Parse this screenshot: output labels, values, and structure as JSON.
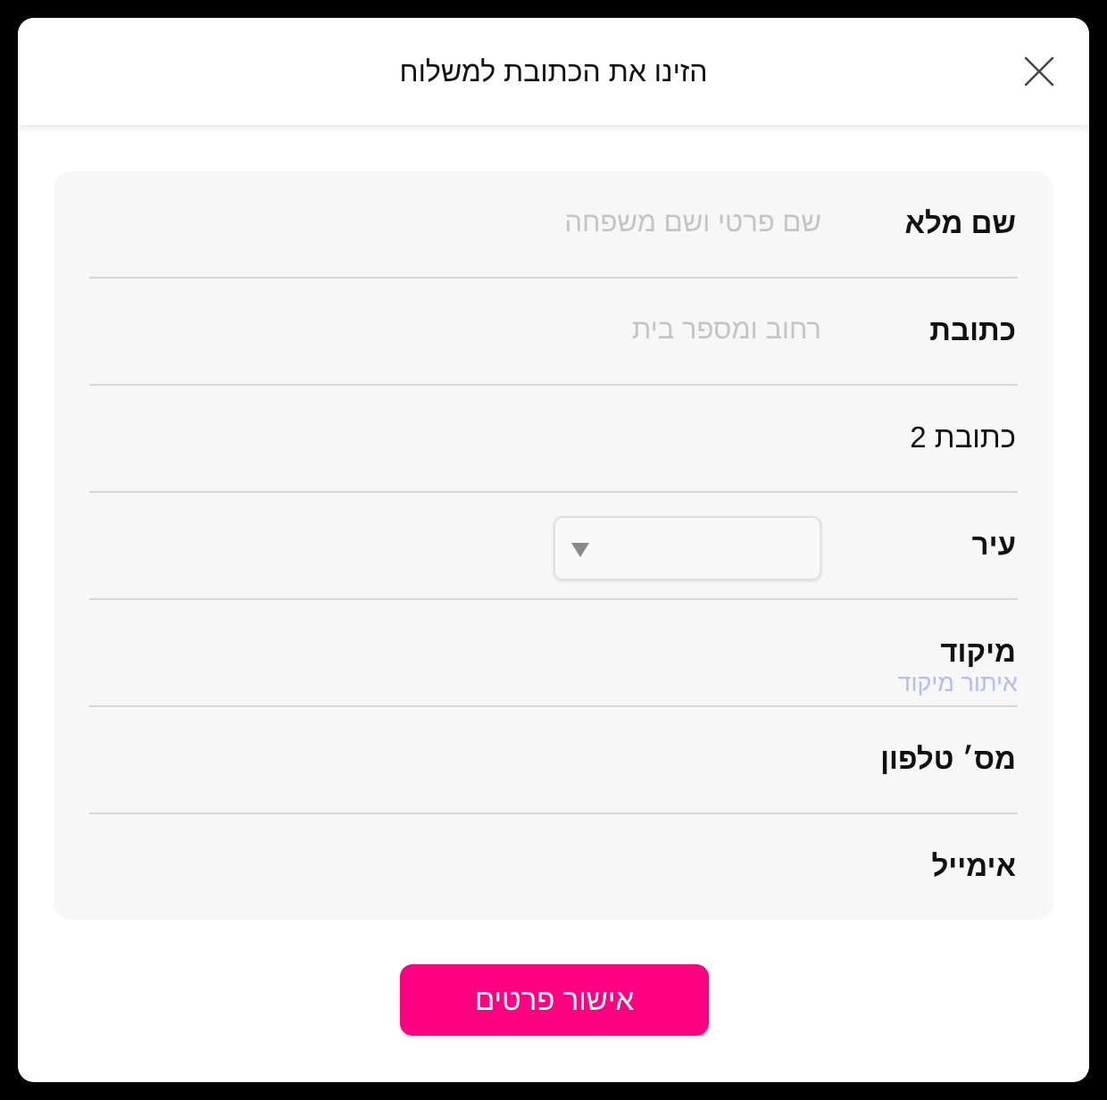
{
  "modal": {
    "title": "הזינו את הכתובת למשלוח",
    "close_icon": "close-icon"
  },
  "form": {
    "full_name": {
      "label": "שם מלא",
      "placeholder": "שם פרטי ושם משפחה",
      "value": ""
    },
    "address": {
      "label": "כתובת",
      "placeholder": "רחוב ומספר בית",
      "value": ""
    },
    "address2": {
      "label": "כתובת 2",
      "value": ""
    },
    "city": {
      "label": "עיר",
      "selected": "",
      "arrow_icon": "chevron-down-icon"
    },
    "zip": {
      "label": "מיקוד",
      "link_text": "איתור מיקוד",
      "value": ""
    },
    "phone": {
      "label": "מס׳ טלפון",
      "value": ""
    },
    "email": {
      "label": "אימייל",
      "value": ""
    }
  },
  "actions": {
    "confirm_label": "אישור פרטים"
  },
  "colors": {
    "accent": "#ff0080",
    "link": "#b4bcf2",
    "card_bg": "#f7f7f7"
  }
}
